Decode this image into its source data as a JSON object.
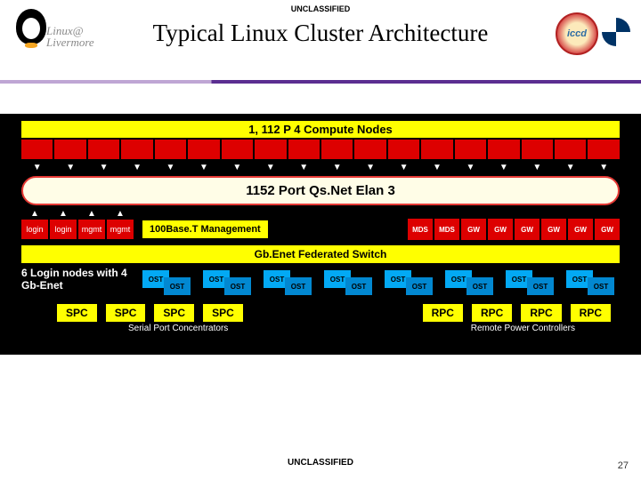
{
  "classification_top": "UNCLASSIFIED",
  "classification_bottom": "UNCLASSIFIED",
  "title": "Typical Linux Cluster Architecture",
  "brand": {
    "line1": "Linux@",
    "line2": "Livermore",
    "badge": "iccd"
  },
  "compute_header": "1, 112 P 4 Compute Nodes",
  "compute_node_count": 18,
  "fabric_label": "1152 Port Qs.Net Elan 3",
  "login_nodes": [
    "login",
    "login",
    "mgmt",
    "mgmt"
  ],
  "mgmt_band": "100Base.T Management",
  "right_service_nodes": [
    "MDS",
    "MDS",
    "GW",
    "GW",
    "GW",
    "GW",
    "GW",
    "GW"
  ],
  "federated": "Gb.Enet Federated Switch",
  "login_note": "6 Login nodes with 4 Gb-Enet",
  "ost_count": 16,
  "ost_label": "OST",
  "spc": [
    "SPC",
    "SPC",
    "SPC",
    "SPC"
  ],
  "spc_caption": "Serial Port Concentrators",
  "rpc": [
    "RPC",
    "RPC",
    "RPC",
    "RPC"
  ],
  "rpc_caption": "Remote Power Controllers",
  "page_number": "27"
}
